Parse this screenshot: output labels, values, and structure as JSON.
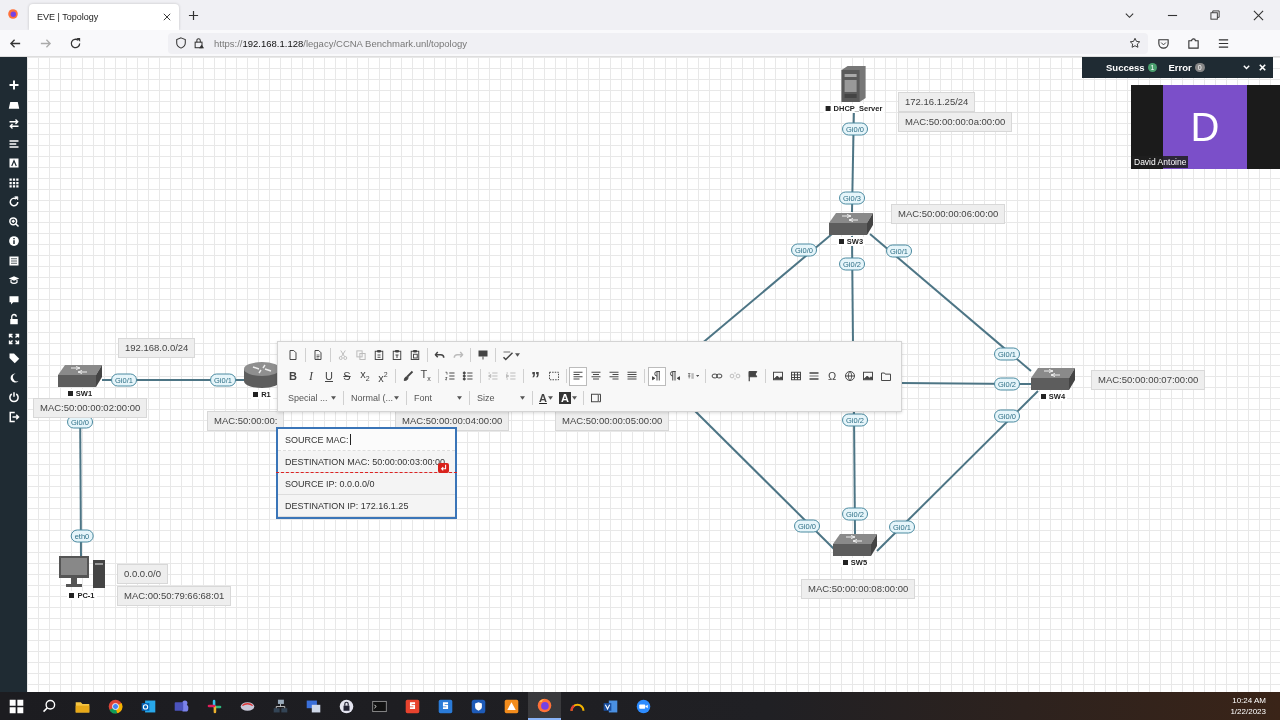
{
  "browser": {
    "tab_title": "EVE | Topology",
    "url": {
      "scheme": "https://",
      "host": "192.168.1.128",
      "path": "/legacy/CCNA Benchmark.unl/topology"
    }
  },
  "sidebar": {
    "tools": [
      {
        "kind": "plus"
      },
      {
        "kind": "node"
      },
      {
        "kind": "swap"
      },
      {
        "kind": "lines"
      },
      {
        "kind": "textbox"
      },
      {
        "kind": "grid"
      },
      {
        "kind": "refresh"
      },
      {
        "kind": "zoom"
      },
      {
        "kind": "info"
      },
      {
        "kind": "doclist"
      },
      {
        "kind": "cap"
      },
      {
        "kind": "chat"
      },
      {
        "kind": "unlock"
      },
      {
        "kind": "expand"
      },
      {
        "kind": "tag"
      },
      {
        "kind": "moon"
      },
      {
        "kind": "power"
      },
      {
        "kind": "logout"
      }
    ]
  },
  "notifications": {
    "success_label": "Success",
    "success_count": "1",
    "error_label": "Error",
    "error_count": "0"
  },
  "video_tile": {
    "initial": "D",
    "name": "David Antoine"
  },
  "nodes": [
    {
      "kind": "switch",
      "name": "SW1"
    },
    {
      "kind": "router",
      "name": "R1"
    },
    {
      "kind": "pc",
      "name": "PC-1"
    },
    {
      "kind": "server",
      "name": "DHCP_Server"
    },
    {
      "kind": "switch",
      "name": "SW3"
    },
    {
      "kind": "switch",
      "name": "SW4"
    },
    {
      "kind": "switch",
      "name": "SW5"
    }
  ],
  "ports": [
    "Gi0/1",
    "Gi0/1",
    "Gi0/0",
    "eth0",
    "Gi0/0",
    "Gi0/3",
    "Gi0/0",
    "Gi0/2",
    "Gi0/1",
    "Gi0/1",
    "Gi0/2",
    "Gi0/0",
    "Gi0/2",
    "Gi0/2",
    "Gi0/0",
    "Gi0/1"
  ],
  "text_labels": [
    "192.168.0.0/24",
    "MAC:50:00:00:02:00:00",
    "MAC:50:00:00:",
    "MAC:50:00:00:04:00:00",
    "MAC:50:00:00:05:00:00",
    "0.0.0.0/0",
    "MAC:00:50:79:66:68:01",
    "172.16.1.25/24",
    "MAC:50:00:00:0a:00:00",
    "MAC:50:00:00:06:00:00",
    "MAC:50:00:00:07:00:00",
    "MAC:50:00:00:08:00:00"
  ],
  "editor": {
    "toolbar_rows": [
      [
        [
          {
            "kind": "newpage",
            "disabled": false,
            "selected": false
          }
        ],
        [
          {
            "kind": "preview",
            "disabled": false,
            "selected": false
          }
        ],
        [
          {
            "kind": "cut",
            "disabled": true,
            "selected": false
          },
          {
            "kind": "copy",
            "disabled": true,
            "selected": false
          },
          {
            "kind": "paste",
            "disabled": false,
            "selected": false
          },
          {
            "kind": "pastetext",
            "disabled": false,
            "selected": false
          },
          {
            "kind": "pasteword",
            "disabled": false,
            "selected": false
          }
        ],
        [
          {
            "kind": "undo",
            "disabled": false,
            "selected": false
          },
          {
            "kind": "redo",
            "disabled": true,
            "selected": false
          }
        ],
        [
          {
            "kind": "template",
            "disabled": false,
            "selected": false
          }
        ],
        [
          {
            "kind": "spellcheck",
            "disabled": false,
            "selected": false,
            "has_menu": true
          }
        ]
      ],
      [
        [
          {
            "kind": "bold",
            "text": "B",
            "disabled": false,
            "selected": false
          },
          {
            "kind": "italic",
            "text": "I",
            "disabled": false,
            "selected": false
          },
          {
            "kind": "underline",
            "text": "U",
            "disabled": false,
            "selected": false
          },
          {
            "kind": "strike",
            "text": "S",
            "disabled": false,
            "selected": false
          },
          {
            "kind": "subscript",
            "text": "x$_{2}$",
            "disabled": false,
            "selected": false
          },
          {
            "kind": "superscript",
            "text": "x$^{2}$",
            "disabled": false,
            "selected": false
          }
        ],
        [
          {
            "kind": "brush",
            "disabled": false,
            "selected": false
          },
          {
            "kind": "clearformat",
            "text": "T$_{x}$",
            "disabled": false,
            "selected": false
          }
        ],
        [
          {
            "kind": "olist",
            "disabled": false,
            "selected": false
          },
          {
            "kind": "ulist",
            "disabled": false,
            "selected": false
          }
        ],
        [
          {
            "kind": "outdent",
            "disabled": true,
            "selected": false
          },
          {
            "kind": "indent",
            "disabled": true,
            "selected": false
          }
        ],
        [
          {
            "kind": "quote",
            "text": "”",
            "disabled": false,
            "selected": false
          },
          {
            "kind": "div",
            "disabled": false,
            "selected": false
          }
        ],
        [
          {
            "kind": "alignleft",
            "disabled": false,
            "selected": true
          },
          {
            "kind": "aligncenter",
            "disabled": false,
            "selected": false
          },
          {
            "kind": "alignright",
            "disabled": false,
            "selected": false
          },
          {
            "kind": "justify",
            "disabled": false,
            "selected": false
          }
        ],
        [
          {
            "kind": "ltr",
            "disabled": false,
            "selected": true
          },
          {
            "kind": "rtl",
            "disabled": false,
            "selected": false
          },
          {
            "kind": "language",
            "disabled": false,
            "selected": false,
            "has_menu": true
          }
        ],
        [
          {
            "kind": "link",
            "disabled": false,
            "selected": false
          },
          {
            "kind": "unlink",
            "disabled": true,
            "selected": false
          },
          {
            "kind": "anchor",
            "disabled": false,
            "selected": false
          }
        ],
        [
          {
            "kind": "image",
            "disabled": false,
            "selected": false
          },
          {
            "kind": "table",
            "disabled": false,
            "selected": false
          },
          {
            "kind": "hr",
            "disabled": false,
            "selected": false
          },
          {
            "kind": "special",
            "text": "Ω",
            "disabled": false,
            "selected": false
          },
          {
            "kind": "iframe",
            "disabled": false,
            "selected": false
          },
          {
            "kind": "image",
            "disabled": false,
            "selected": false
          },
          {
            "kind": "frame",
            "disabled": false,
            "selected": false
          }
        ]
      ],
      [
        [
          {
            "kind": "textcolor",
            "text": "A",
            "disabled": false,
            "selected": false,
            "has_menu": true
          },
          {
            "kind": "bgcolor",
            "text": "A",
            "disabled": false,
            "selected": false,
            "has_menu": true
          }
        ],
        [
          {
            "kind": "maximize",
            "disabled": false,
            "selected": false
          }
        ]
      ]
    ],
    "dropdowns": [
      "Special ...",
      "Normal (...",
      "Font",
      "Size"
    ],
    "lines": [
      {
        "text": "SOURCE MAC:",
        "focused": true,
        "marker_below": false
      },
      {
        "text": "DESTINATION MAC: 50:00:00:03:00:00",
        "focused": false,
        "marker_below": true
      },
      {
        "text": "SOURCE IP: 0.0.0.0/0",
        "focused": false,
        "marker_below": false
      },
      {
        "text": "DESTINATION  IP: 172.16.1.25",
        "focused": false,
        "marker_below": false
      }
    ]
  },
  "taskbar": {
    "apps": [
      {
        "kind": "windows",
        "selected": false
      },
      {
        "kind": "search",
        "selected": false
      },
      {
        "kind": "folder",
        "selected": false
      },
      {
        "kind": "chrome",
        "selected": false
      },
      {
        "kind": "outlook",
        "selected": false
      },
      {
        "kind": "teams",
        "selected": false
      },
      {
        "kind": "slack",
        "selected": false
      },
      {
        "kind": "gadget",
        "selected": false
      },
      {
        "kind": "network",
        "selected": false
      },
      {
        "kind": "remote",
        "selected": false
      },
      {
        "kind": "lock",
        "selected": false
      },
      {
        "kind": "terminal",
        "selected": false
      },
      {
        "kind": "redsquare",
        "selected": false
      },
      {
        "kind": "bluesquare",
        "selected": false
      },
      {
        "kind": "shield",
        "selected": false
      },
      {
        "kind": "orange",
        "selected": false
      },
      {
        "kind": "firefox",
        "selected": true
      },
      {
        "kind": "gauge",
        "selected": false
      },
      {
        "kind": "visio",
        "selected": false
      },
      {
        "kind": "zoom",
        "selected": false
      }
    ],
    "time": "10:24 AM",
    "date": "1/22/2023"
  }
}
